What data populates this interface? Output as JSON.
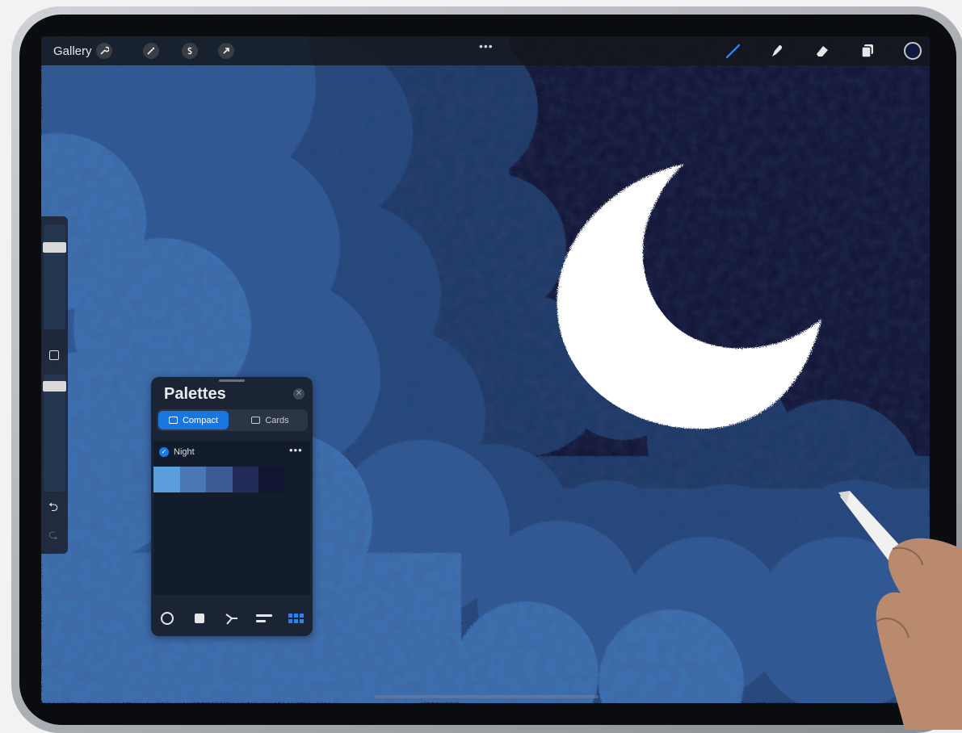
{
  "app": {
    "gallery_label": "Gallery",
    "more_dots": "•••"
  },
  "toolbar": {
    "left_tools": [
      {
        "name": "actions",
        "icon": "wrench-icon"
      },
      {
        "name": "adjustments",
        "icon": "magic-wand-icon"
      },
      {
        "name": "selection",
        "icon": "selection-s-icon"
      },
      {
        "name": "transform",
        "icon": "arrow-cursor-icon"
      }
    ],
    "right_tools": [
      {
        "name": "brush",
        "icon": "brush-icon",
        "active": true
      },
      {
        "name": "smudge",
        "icon": "smudge-finger-icon",
        "active": false
      },
      {
        "name": "eraser",
        "icon": "eraser-icon",
        "active": false
      },
      {
        "name": "layers",
        "icon": "layers-icon",
        "active": false
      }
    ],
    "current_color": "#101840",
    "accent_color": "#1d86ff"
  },
  "sidebar": {
    "brush_size_level": 0.9,
    "opacity_level": 0.95
  },
  "palettes_panel": {
    "title": "Palettes",
    "tabs": {
      "compact_label": "Compact",
      "cards_label": "Cards",
      "selected": "compact"
    },
    "palette": {
      "name": "Night",
      "default": true,
      "more_label": "•••",
      "swatches": [
        "#5a9fdc",
        "#4a78b4",
        "#3c5a94",
        "#232c58",
        "#121632"
      ]
    },
    "bottom_icons": [
      "disc-icon",
      "classic-square-icon",
      "harmony-icon",
      "value-bars-icon",
      "palettes-grid-icon"
    ]
  },
  "canvas": {
    "sky_color": "#0f1232",
    "cloud_colors": [
      "#3d71b3",
      "#2f5a96",
      "#24447a",
      "#1c3565"
    ],
    "moon_color": "#ffffff"
  }
}
